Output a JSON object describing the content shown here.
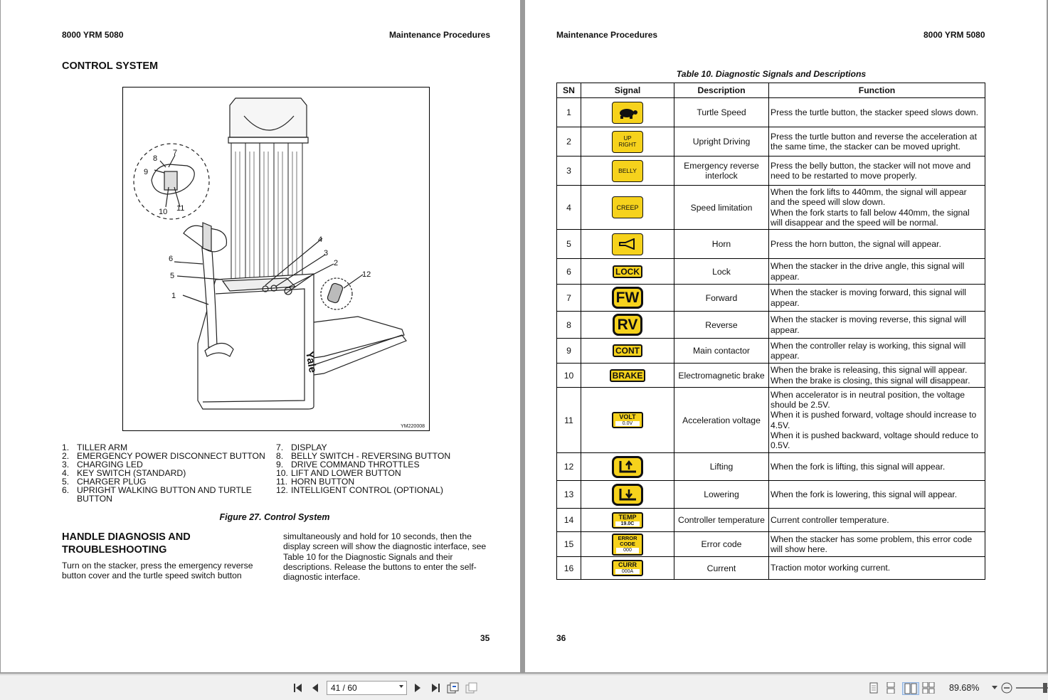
{
  "left_page": {
    "header_left": "8000 YRM 5080",
    "header_right": "Maintenance Procedures",
    "section_title": "CONTROL SYSTEM",
    "figure_id": "YM220008",
    "figure_brand": "Yale",
    "callouts": [
      "1",
      "2",
      "3",
      "4",
      "5",
      "6",
      "7",
      "8",
      "9",
      "10",
      "11",
      "12"
    ],
    "legend": [
      {
        "num": "1.",
        "text": "TILLER ARM"
      },
      {
        "num": "2.",
        "text": "EMERGENCY POWER DISCONNECT BUTTON"
      },
      {
        "num": "3.",
        "text": "CHARGING LED"
      },
      {
        "num": "4.",
        "text": "KEY SWITCH (STANDARD)"
      },
      {
        "num": "5.",
        "text": "CHARGER PLUG"
      },
      {
        "num": "6.",
        "text": "UPRIGHT WALKING BUTTON AND TURTLE BUTTON"
      },
      {
        "num": "7.",
        "text": "DISPLAY"
      },
      {
        "num": "8.",
        "text": "BELLY SWITCH - REVERSING BUTTON"
      },
      {
        "num": "9.",
        "text": "DRIVE COMMAND THROTTLES"
      },
      {
        "num": "10.",
        "text": "LIFT AND LOWER BUTTON"
      },
      {
        "num": "11.",
        "text": "HORN BUTTON"
      },
      {
        "num": "12.",
        "text": "INTELLIGENT CONTROL (OPTIONAL)"
      }
    ],
    "figure_caption": "Figure 27. Control System",
    "section2_title_line1": "HANDLE DIAGNOSIS AND",
    "section2_title_line2": "TROUBLESHOOTING",
    "para_col1": "Turn on the stacker, press the emergency reverse button cover and the turtle speed switch button",
    "para_col2": "simultaneously and hold for 10 seconds, then the display screen will show the diagnostic interface, see Table 10 for the Diagnostic Signals and their descriptions. Release the buttons to enter the self-diagnostic interface.",
    "page_number": "35"
  },
  "right_page": {
    "header_left": "Maintenance Procedures",
    "header_right": "8000 YRM 5080",
    "table_caption": "Table 10. Diagnostic Signals and Descriptions",
    "columns": [
      "SN",
      "Signal",
      "Description",
      "Function"
    ],
    "rows": [
      {
        "sn": "1",
        "icon": "turtle-icon",
        "desc": "Turtle Speed",
        "func": "Press the turtle button, the stacker speed slows down."
      },
      {
        "sn": "2",
        "icon": "upright-icon",
        "icon_text": "UP RIGHT",
        "desc": "Upright Driving",
        "func": "Press the turtle button and reverse the acceleration at the same time, the stacker can be moved upright."
      },
      {
        "sn": "3",
        "icon": "belly-icon",
        "icon_text": "BELLY",
        "desc": "Emergency reverse interlock",
        "func": "Press the belly button, the stacker will not move and need to be restarted to move properly."
      },
      {
        "sn": "4",
        "icon": "creep-icon",
        "icon_text": "CREEP",
        "desc": "Speed limitation",
        "func": "When the fork lifts to 440mm, the signal will appear and the speed will slow down.\nWhen the fork starts to fall below 440mm, the signal will disappear and the speed will be normal."
      },
      {
        "sn": "5",
        "icon": "horn-icon",
        "desc": "Horn",
        "func": "Press the horn button, the signal will appear."
      },
      {
        "sn": "6",
        "icon": "lock-icon",
        "icon_text": "LOCK",
        "desc": "Lock",
        "func": "When the stacker in the drive angle, this signal will appear."
      },
      {
        "sn": "7",
        "icon": "forward-icon",
        "icon_text": "FW",
        "desc": "Forward",
        "func": "When the stacker is moving forward, this signal will appear."
      },
      {
        "sn": "8",
        "icon": "reverse-icon",
        "icon_text": "RV",
        "desc": "Reverse",
        "func": "When the stacker is moving reverse, this signal will appear."
      },
      {
        "sn": "9",
        "icon": "contactor-icon",
        "icon_text": "CONT",
        "desc": "Main contactor",
        "func": "When the controller relay is working, this signal will appear."
      },
      {
        "sn": "10",
        "icon": "brake-icon",
        "icon_text": "BRAKE",
        "desc": "Electromagnetic brake",
        "func": "When the brake is releasing, this signal will appear.\nWhen the brake is closing, this signal will disappear."
      },
      {
        "sn": "11",
        "icon": "voltage-icon",
        "icon_text": "VOLT",
        "icon_value": "0.0V",
        "desc": "Acceleration voltage",
        "func": "When accelerator is in neutral position, the voltage should be 2.5V.\nWhen it is pushed forward, voltage should increase to 4.5V.\nWhen it is pushed backward, voltage should reduce to 0.5V."
      },
      {
        "sn": "12",
        "icon": "lifting-icon",
        "desc": "Lifting",
        "func": "When the fork is lifting, this signal will appear."
      },
      {
        "sn": "13",
        "icon": "lowering-icon",
        "desc": "Lowering",
        "func": "When the fork is lowering, this signal will appear."
      },
      {
        "sn": "14",
        "icon": "temperature-icon",
        "icon_text": "TEMP",
        "icon_value": "19.0C",
        "desc": "Controller temperature",
        "func": "Current controller temperature."
      },
      {
        "sn": "15",
        "icon": "error-code-icon",
        "icon_text": "ERROR CODE",
        "icon_value": "000",
        "desc": "Error code",
        "func": "When the stacker has some problem, this error code will show here."
      },
      {
        "sn": "16",
        "icon": "current-icon",
        "icon_text": "CURR",
        "icon_value": "000A",
        "desc": "Current",
        "func": "Traction motor working current."
      }
    ],
    "page_number": "36"
  },
  "toolbar": {
    "page_indicator": "41 / 60",
    "zoom_level": "89.68%"
  },
  "colors": {
    "signal_yellow": "#f6d21c",
    "viewer_gray": "#9a9a9a",
    "toolbar_bg": "#f0f0f0"
  }
}
